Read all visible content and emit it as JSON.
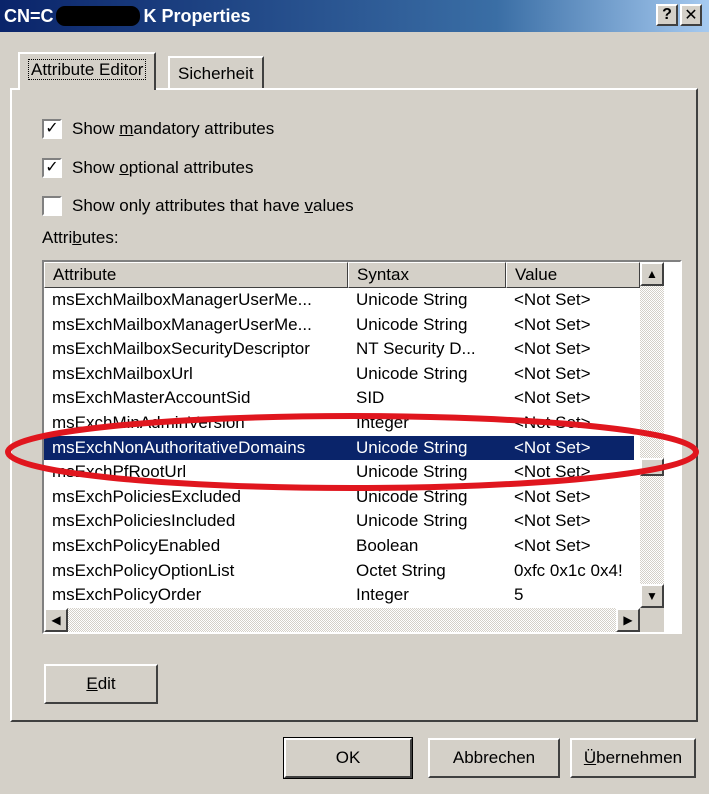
{
  "window": {
    "title_prefix": "CN=C",
    "title_suffix": "K Properties",
    "help_button": "?",
    "close_button": "✕"
  },
  "tabs": [
    {
      "label": "Attribute Editor",
      "active": true
    },
    {
      "label": "Sicherheit",
      "active": false
    }
  ],
  "options": [
    {
      "pre": "Show ",
      "key": "m",
      "post": "andatory attributes",
      "checked": true
    },
    {
      "pre": "Show ",
      "key": "o",
      "post": "ptional attributes",
      "checked": true
    },
    {
      "pre": "Show only attributes that have ",
      "key": "v",
      "post": "alues",
      "checked": false
    }
  ],
  "attributes_label": {
    "pre": "Attri",
    "key": "b",
    "post": "utes:"
  },
  "table": {
    "columns": [
      "Attribute",
      "Syntax",
      "Value"
    ],
    "rows": [
      {
        "attribute": "msExchMailboxManagerUserMe...",
        "syntax": "Unicode String",
        "value": "<Not Set>"
      },
      {
        "attribute": "msExchMailboxManagerUserMe...",
        "syntax": "Unicode String",
        "value": "<Not Set>"
      },
      {
        "attribute": "msExchMailboxSecurityDescriptor",
        "syntax": "NT Security D...",
        "value": "<Not Set>"
      },
      {
        "attribute": "msExchMailboxUrl",
        "syntax": "Unicode String",
        "value": "<Not Set>"
      },
      {
        "attribute": "msExchMasterAccountSid",
        "syntax": "SID",
        "value": "<Not Set>"
      },
      {
        "attribute": "msExchMinAdminVersion",
        "syntax": "Integer",
        "value": "<Not Set>"
      },
      {
        "attribute": "msExchNonAuthoritativeDomains",
        "syntax": "Unicode String",
        "value": "<Not Set>",
        "selected": true
      },
      {
        "attribute": "msExchPfRootUrl",
        "syntax": "Unicode String",
        "value": "<Not Set>"
      },
      {
        "attribute": "msExchPoliciesExcluded",
        "syntax": "Unicode String",
        "value": "<Not Set>"
      },
      {
        "attribute": "msExchPoliciesIncluded",
        "syntax": "Unicode String",
        "value": "<Not Set>"
      },
      {
        "attribute": "msExchPolicyEnabled",
        "syntax": "Boolean",
        "value": "<Not Set>"
      },
      {
        "attribute": "msExchPolicyOptionList",
        "syntax": "Octet String",
        "value": "0xfc 0x1c 0x4!"
      },
      {
        "attribute": "msExchPolicyOrder",
        "syntax": "Integer",
        "value": "5"
      }
    ]
  },
  "buttons": {
    "edit": {
      "pre": "",
      "key": "E",
      "post": "dit"
    },
    "ok": "OK",
    "cancel": "Abbrechen",
    "apply": {
      "pre": "",
      "key": "Ü",
      "post": "bernehmen"
    }
  },
  "colors": {
    "selection": "#0a246a",
    "annotation": "#e0161e",
    "face": "#d4d0c8"
  }
}
